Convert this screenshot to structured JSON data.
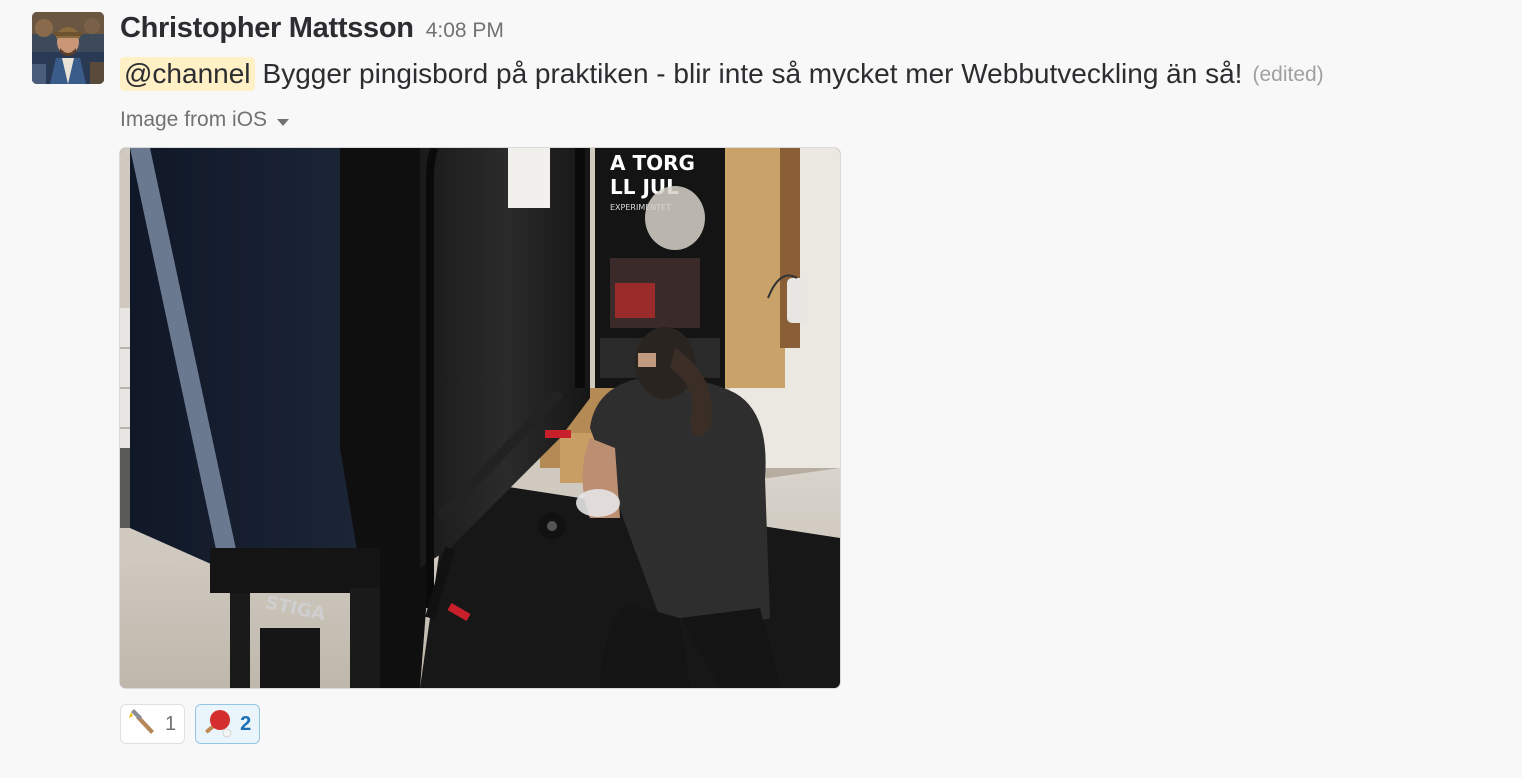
{
  "message": {
    "sender": "Christopher Mattsson",
    "timestamp": "4:08 PM",
    "mention": "@channel",
    "text": "Bygger pingisbord på praktiken - blir inte så mycket mer Webbutveckling än så!",
    "edited_label": "(edited)",
    "avatar_icon": "user-avatar"
  },
  "attachment": {
    "label": "Image from iOS",
    "toggle_icon": "caret-down-icon",
    "poster_text": {
      "line1": "A TORG",
      "line2": "LL JUL",
      "line3": "EXPERIMENTET"
    },
    "table_brand": "STIGA"
  },
  "reactions": [
    {
      "emoji": "hammer",
      "count": "1",
      "active": false
    },
    {
      "emoji": "table-tennis-paddle",
      "count": "2",
      "active": true
    }
  ],
  "colors": {
    "background": "#f8f8f8",
    "mention_highlight": "#fff0c6",
    "active_reaction_bg": "#eaf4fb",
    "active_reaction_border": "#95c5e4",
    "active_reaction_text": "#1d6fb3"
  }
}
